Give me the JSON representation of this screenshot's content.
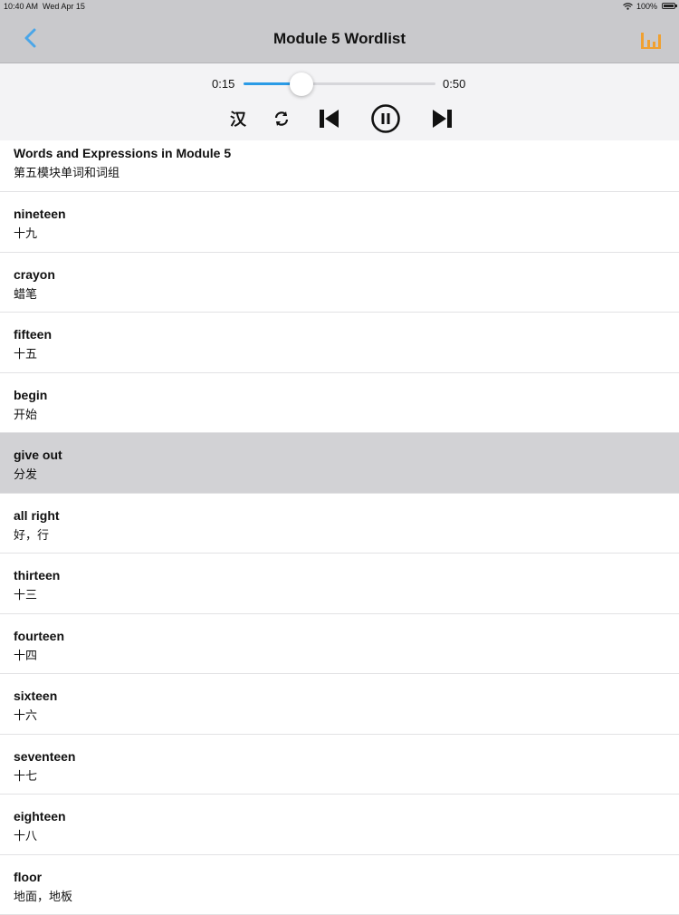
{
  "status": {
    "time": "10:40 AM",
    "date": "Wed Apr 15",
    "battery": "100%"
  },
  "nav": {
    "title": "Module 5  Wordlist",
    "back_icon": "chevron-left-icon",
    "chart_icon": "bar-chart-icon"
  },
  "player": {
    "current_time": "0:15",
    "total_time": "0:50",
    "progress": 0.3,
    "han_label": "汉",
    "icons": [
      "repeat-icon",
      "skip-back-icon",
      "pause-icon",
      "skip-forward-icon"
    ]
  },
  "colors": {
    "accent": "#2a9be6",
    "chart_icon": "#f0a030",
    "selected_row": "#d2d2d5",
    "bar_bg": "#c9c9cc"
  },
  "list": {
    "header": {
      "word": "Words and Expressions in Module 5",
      "meaning": "第五模块单词和词组"
    },
    "items": [
      {
        "word": "nineteen",
        "meaning": "十九"
      },
      {
        "word": "crayon",
        "meaning": "蜡笔"
      },
      {
        "word": "fifteen",
        "meaning": "十五"
      },
      {
        "word": "begin",
        "meaning": "开始"
      },
      {
        "word": "give out",
        "meaning": "分发",
        "selected": true
      },
      {
        "word": "all right",
        "meaning": "好，行"
      },
      {
        "word": "thirteen",
        "meaning": "十三"
      },
      {
        "word": "fourteen",
        "meaning": "十四"
      },
      {
        "word": "sixteen",
        "meaning": "十六"
      },
      {
        "word": "seventeen",
        "meaning": "十七"
      },
      {
        "word": "eighteen",
        "meaning": "十八"
      },
      {
        "word": "floor",
        "meaning": "地面，地板"
      }
    ]
  }
}
